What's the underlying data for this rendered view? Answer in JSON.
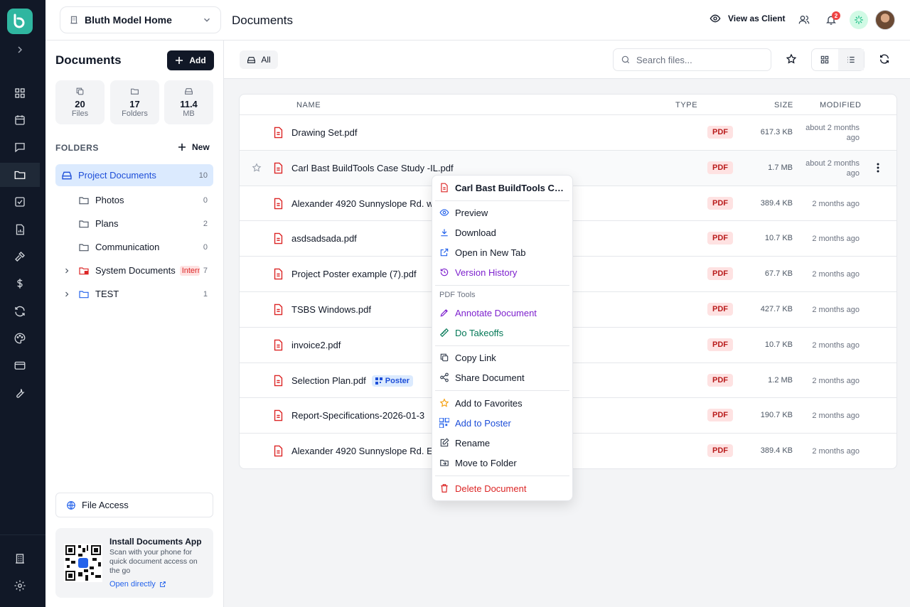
{
  "header": {
    "project_name": "Bluth Model Home",
    "page_title": "Documents",
    "view_as_client": "View as Client",
    "notification_count": "2"
  },
  "panel": {
    "title": "Documents",
    "add_label": "Add",
    "stats": [
      {
        "value": "20",
        "label": "Files"
      },
      {
        "value": "17",
        "label": "Folders"
      },
      {
        "value": "11.4",
        "label": "MB"
      }
    ],
    "folders_heading": "FOLDERS",
    "new_label": "New",
    "folders": [
      {
        "name": "Project Documents",
        "count": "10"
      },
      {
        "name": "Photos",
        "count": "0"
      },
      {
        "name": "Plans",
        "count": "2"
      },
      {
        "name": "Communication",
        "count": "0"
      },
      {
        "name": "System Documents",
        "tag": "Internal",
        "count": "7"
      },
      {
        "name": "TEST",
        "count": "1"
      }
    ],
    "file_access": "File Access",
    "install": {
      "title": "Install Documents App",
      "description": "Scan with your phone for quick document access on the go",
      "link": "Open directly"
    }
  },
  "toolbar": {
    "all_label": "All",
    "search_placeholder": "Search files..."
  },
  "table": {
    "headers": {
      "name": "NAME",
      "type": "TYPE",
      "size": "SIZE",
      "modified": "MODIFIED"
    },
    "rows": [
      {
        "name": "Drawing Set.pdf",
        "type": "PDF",
        "size": "617.3 KB",
        "modified": "about 2 months ago"
      },
      {
        "name": "Carl Bast BuildTools Case Study -IL.pdf",
        "type": "PDF",
        "size": "1.7 MB",
        "modified": "about 2 months ago"
      },
      {
        "name": "Alexander 4920 Sunnyslope Rd. w",
        "type": "PDF",
        "size": "389.4 KB",
        "modified": "2 months ago"
      },
      {
        "name": "asdsadsada.pdf",
        "type": "PDF",
        "size": "10.7 KB",
        "modified": "2 months ago"
      },
      {
        "name": "Project Poster example (7).pdf",
        "type": "PDF",
        "size": "67.7 KB",
        "modified": "2 months ago"
      },
      {
        "name": "TSBS Windows.pdf",
        "type": "PDF",
        "size": "427.7 KB",
        "modified": "2 months ago"
      },
      {
        "name": "invoice2.pdf",
        "type": "PDF",
        "size": "10.7 KB",
        "modified": "2 months ago"
      },
      {
        "name": "Selection Plan.pdf",
        "tag": "Poster",
        "type": "PDF",
        "size": "1.2 MB",
        "modified": "2 months ago"
      },
      {
        "name": "Report-Specifications-2026-01-3",
        "type": "PDF",
        "size": "190.7 KB",
        "modified": "2 months ago"
      },
      {
        "name": "Alexander 4920 Sunnyslope Rd. E",
        "type": "PDF",
        "size": "389.4 KB",
        "modified": "2 months ago"
      }
    ]
  },
  "context_menu": {
    "title": "Carl Bast BuildTools Cas...",
    "preview": "Preview",
    "download": "Download",
    "open_new_tab": "Open in New Tab",
    "version_history": "Version History",
    "pdf_tools": "PDF Tools",
    "annotate": "Annotate Document",
    "takeoffs": "Do Takeoffs",
    "copy_link": "Copy Link",
    "share": "Share Document",
    "add_favorites": "Add to Favorites",
    "add_poster": "Add to Poster",
    "rename": "Rename",
    "move": "Move to Folder",
    "delete": "Delete Document"
  },
  "colors": {
    "rail_bg": "#111827",
    "accent_teal": "#2fb6a0",
    "active_folder_bg": "#dbeafe",
    "pdf_badge_bg": "#fee2e2",
    "danger": "#dc2626"
  }
}
